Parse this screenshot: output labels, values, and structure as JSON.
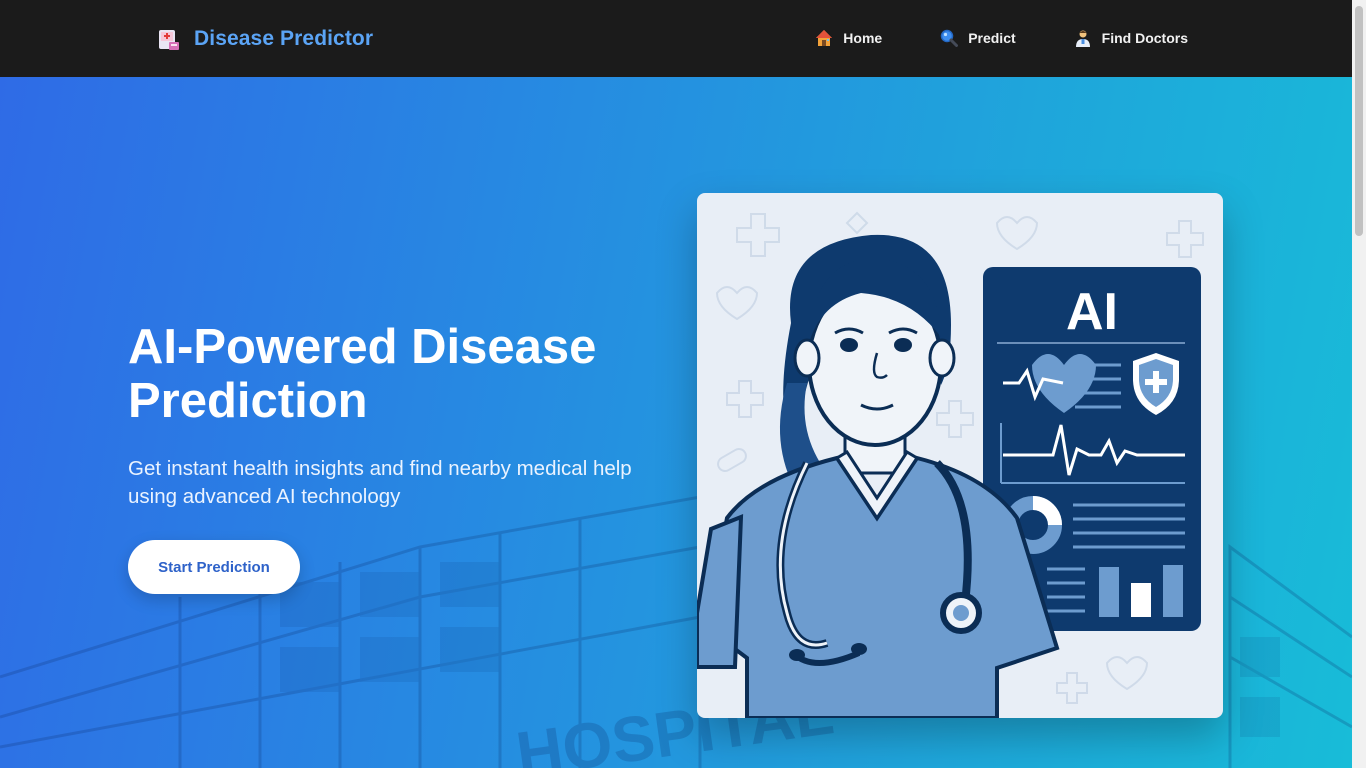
{
  "nav": {
    "brand_title": "Disease Predictor",
    "brand_icon": "hospital-icon",
    "links": [
      {
        "label": "Home",
        "icon": "house-icon"
      },
      {
        "label": "Predict",
        "icon": "magnifier-icon"
      },
      {
        "label": "Find Doctors",
        "icon": "doctor-icon"
      }
    ]
  },
  "hero": {
    "title": "AI-Powered Disease Prediction",
    "subtitle": "Get instant health insights and find nearby medical help using advanced AI technology",
    "cta_label": "Start Prediction",
    "illustration_text": "AI",
    "background_sign_text": "HOSPITAL"
  },
  "colors": {
    "navbar_bg": "#1b1b1b",
    "brand": "#5ba4f5",
    "gradient_start": "#2f6be6",
    "gradient_end": "#18bcd8",
    "cta_text": "#2e62c9",
    "illustration_navy": "#0e3a6e"
  }
}
